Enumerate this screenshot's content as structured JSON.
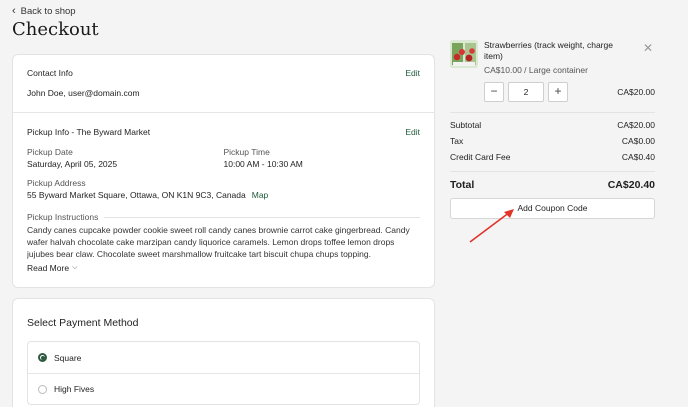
{
  "header": {
    "back_label": "Back to shop",
    "title": "Checkout"
  },
  "contact": {
    "heading": "Contact Info",
    "edit_label": "Edit",
    "value": "John Doe, user@domain.com"
  },
  "pickup": {
    "heading": "Pickup Info - The Byward Market",
    "edit_label": "Edit",
    "date_label": "Pickup Date",
    "date_value": "Saturday, April 05, 2025",
    "time_label": "Pickup Time",
    "time_value": "10:00 AM - 10:30 AM",
    "address_label": "Pickup Address",
    "address_value": "55 Byward Market Square, Ottawa, ON K1N 9C3, Canada",
    "map_label": "Map",
    "instructions_label": "Pickup Instructions",
    "instructions_text": "Candy canes cupcake powder cookie sweet roll candy canes brownie carrot cake gingerbread. Candy wafer halvah chocolate cake marzipan candy liquorice caramels. Lemon drops toffee lemon drops jujubes bear claw. Chocolate sweet marshmallow fruitcake tart biscuit chupa chups topping.",
    "read_more_label": "Read More"
  },
  "payment": {
    "heading": "Select Payment Method",
    "options": [
      {
        "label": "Square",
        "selected": true
      },
      {
        "label": "High Fives",
        "selected": false
      }
    ]
  },
  "cart": {
    "item": {
      "name": "Strawberries (track weight, charge item)",
      "unit": "CA$10.00 / Large container",
      "quantity": "2",
      "line_total": "CA$20.00"
    },
    "subtotal_label": "Subtotal",
    "subtotal_value": "CA$20.00",
    "tax_label": "Tax",
    "tax_value": "CA$0.00",
    "fee_label": "Credit Card Fee",
    "fee_value": "CA$0.40",
    "total_label": "Total",
    "total_value": "CA$20.40",
    "coupon_label": "Add Coupon Code"
  },
  "icons": {
    "back": "chevron-left-icon",
    "remove": "close-icon",
    "read_more": "chevron-down-icon",
    "minus": "minus-icon",
    "plus": "plus-icon"
  },
  "colors": {
    "accent_green": "#1e5a3a",
    "annotation_arrow": "#e0352b"
  }
}
